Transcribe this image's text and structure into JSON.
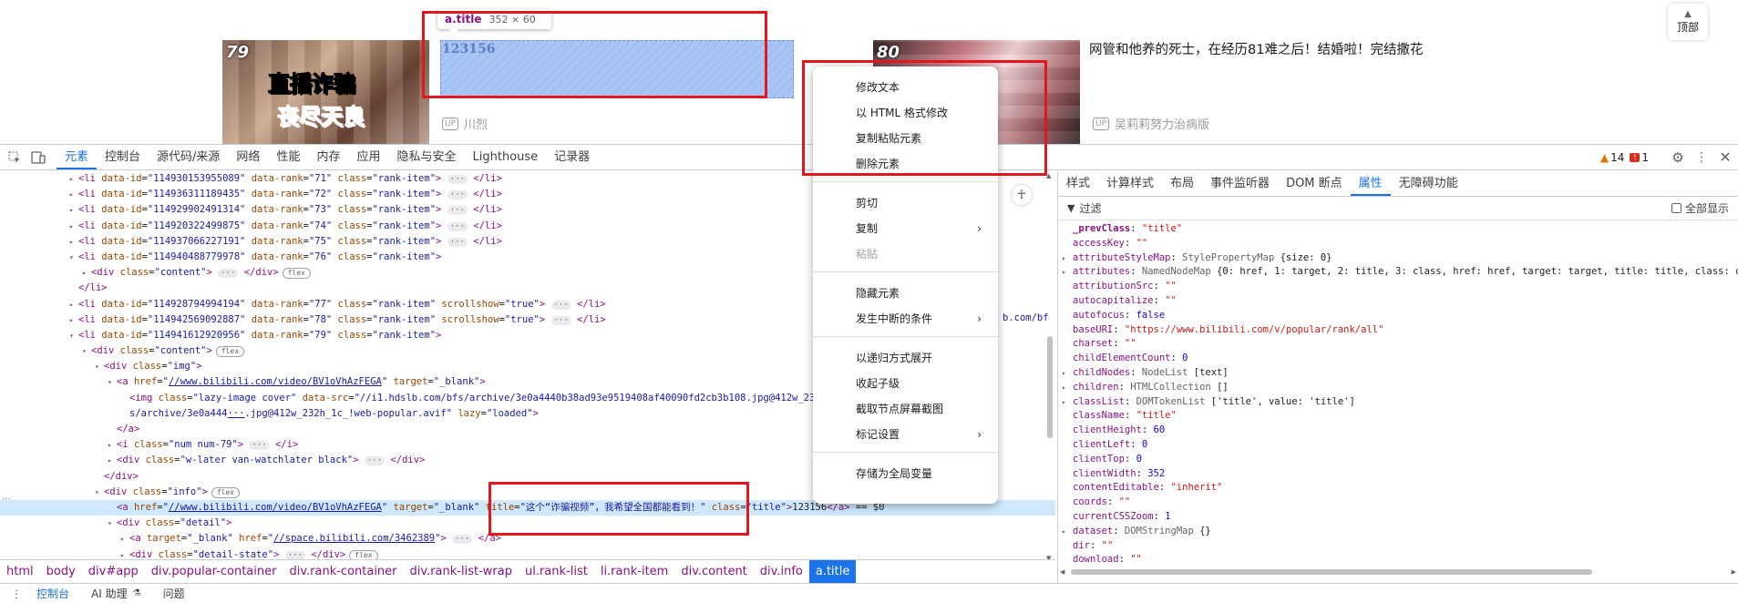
{
  "page_top": {
    "back_to_top": "顶部",
    "card1": {
      "rank": "79",
      "thumb_line1": "直播诈骗",
      "thumb_line2": "丧尽天良",
      "up_badge": "UP",
      "up_name": "川烈"
    },
    "highlight": {
      "tag": "a.title",
      "size": "352 × 60",
      "text": "123156"
    },
    "card2": {
      "rank": "80",
      "title": "网管和他养的死士，在经历81难之后！结婚啦！完结撒花",
      "up_badge": "UP",
      "up_name": "吴莉莉努力治病版"
    }
  },
  "devtools": {
    "tabs": [
      "元素",
      "控制台",
      "源代码/来源",
      "网络",
      "性能",
      "内存",
      "应用",
      "隐私与安全",
      "Lighthouse",
      "记录器"
    ],
    "active_tab": "元素",
    "warnings": "14",
    "errors": "1",
    "side_tabs": [
      "样式",
      "计算样式",
      "布局",
      "事件监听器",
      "DOM 断点",
      "属性",
      "无障碍功能"
    ],
    "active_side_tab": "属性",
    "filter_label": "过滤",
    "show_all": "全部显示",
    "breadcrumbs": [
      "html",
      "body",
      "div#app",
      "div.popular-container",
      "div.rank-container",
      "div.rank-list-wrap",
      "ul.rank-list",
      "li.rank-item",
      "div.content",
      "div.info",
      "a.title"
    ],
    "drawer": [
      "控制台",
      "AI 助理",
      "问题"
    ]
  },
  "dom_lines": [
    {
      "indent": 0,
      "t": "▸",
      "html": "<span class='tg'>&lt;li</span> <span class='an'>data-id</span>=<span class='av'>\"114930153955089\"</span> <span class='an'>data-rank</span>=<span class='av'>\"71\"</span> <span class='an'>class</span>=<span class='av'>\"rank-item\"</span><span class='tg'>&gt;</span> <span class='ell'>···</span> <span class='tg'>&lt;/li&gt;</span>"
    },
    {
      "indent": 0,
      "t": "▸",
      "html": "<span class='tg'>&lt;li</span> <span class='an'>data-id</span>=<span class='av'>\"114936311189435\"</span> <span class='an'>data-rank</span>=<span class='av'>\"72\"</span> <span class='an'>class</span>=<span class='av'>\"rank-item\"</span><span class='tg'>&gt;</span> <span class='ell'>···</span> <span class='tg'>&lt;/li&gt;</span>"
    },
    {
      "indent": 0,
      "t": "▸",
      "html": "<span class='tg'>&lt;li</span> <span class='an'>data-id</span>=<span class='av'>\"114929902491314\"</span> <span class='an'>data-rank</span>=<span class='av'>\"73\"</span> <span class='an'>class</span>=<span class='av'>\"rank-item\"</span><span class='tg'>&gt;</span> <span class='ell'>···</span> <span class='tg'>&lt;/li&gt;</span>"
    },
    {
      "indent": 0,
      "t": "▸",
      "html": "<span class='tg'>&lt;li</span> <span class='an'>data-id</span>=<span class='av'>\"114920322499875\"</span> <span class='an'>data-rank</span>=<span class='av'>\"74\"</span> <span class='an'>class</span>=<span class='av'>\"rank-item\"</span><span class='tg'>&gt;</span> <span class='ell'>···</span> <span class='tg'>&lt;/li&gt;</span>"
    },
    {
      "indent": 0,
      "t": "▸",
      "html": "<span class='tg'>&lt;li</span> <span class='an'>data-id</span>=<span class='av'>\"114937066227191\"</span> <span class='an'>data-rank</span>=<span class='av'>\"75\"</span> <span class='an'>class</span>=<span class='av'>\"rank-item\"</span><span class='tg'>&gt;</span> <span class='ell'>···</span> <span class='tg'>&lt;/li&gt;</span>"
    },
    {
      "indent": 0,
      "t": "▾",
      "html": "<span class='tg'>&lt;li</span> <span class='an'>data-id</span>=<span class='av'>\"114940488779978\"</span> <span class='an'>data-rank</span>=<span class='av'>\"76\"</span> <span class='an'>class</span>=<span class='av'>\"rank-item\"</span><span class='tg'>&gt;</span>"
    },
    {
      "indent": 1,
      "t": "▸",
      "html": "<span class='tg'>&lt;div</span> <span class='an'>class</span>=<span class='av'>\"content\"</span><span class='tg'>&gt;</span> <span class='ell'>···</span> <span class='tg'>&lt;/div&gt;</span><span class='badge'>flex</span>"
    },
    {
      "indent": 0,
      "t": "",
      "html": "<span class='tg'>&lt;/li&gt;</span>"
    },
    {
      "indent": 0,
      "t": "▸",
      "html": "<span class='tg'>&lt;li</span> <span class='an'>data-id</span>=<span class='av'>\"114928794994194\"</span> <span class='an'>data-rank</span>=<span class='av'>\"77\"</span> <span class='an'>class</span>=<span class='av'>\"rank-item\"</span> <span class='an'>scrollshow</span>=<span class='av'>\"true\"</span><span class='tg'>&gt;</span> <span class='ell'>···</span> <span class='tg'>&lt;/li&gt;</span>"
    },
    {
      "indent": 0,
      "t": "▸",
      "html": "<span class='tg'>&lt;li</span> <span class='an'>data-id</span>=<span class='av'>\"114942569092887\"</span> <span class='an'>data-rank</span>=<span class='av'>\"78\"</span> <span class='an'>class</span>=<span class='av'>\"rank-item\"</span> <span class='an'>scrollshow</span>=<span class='av'>\"true\"</span><span class='tg'>&gt;</span> <span class='ell'>···</span> <span class='tg'>&lt;/li&gt;</span>"
    },
    {
      "indent": 0,
      "t": "▾",
      "html": "<span class='tg'>&lt;li</span> <span class='an'>data-id</span>=<span class='av'>\"114941612920956\"</span> <span class='an'>data-rank</span>=<span class='av'>\"79\"</span> <span class='an'>class</span>=<span class='av'>\"rank-item\"</span><span class='tg'>&gt;</span>"
    },
    {
      "indent": 1,
      "t": "▾",
      "html": "<span class='tg'>&lt;div</span> <span class='an'>class</span>=<span class='av'>\"content\"</span><span class='tg'>&gt;</span><span class='badge'>flex</span>"
    },
    {
      "indent": 2,
      "t": "▾",
      "html": "<span class='tg'>&lt;div</span> <span class='an'>class</span>=<span class='av'>\"img\"</span><span class='tg'>&gt;</span>"
    },
    {
      "indent": 3,
      "t": "▾",
      "html": "<span class='tg'>&lt;a</span> <span class='an'>href</span>=<span class='av'>\"<span class='lk'>//www.bilibili.com/video/BV1oVhAzFEGA</span>\"</span> <span class='an'>target</span>=<span class='av'>\"_blank\"</span><span class='tg'>&gt;</span>"
    },
    {
      "indent": 4,
      "t": "",
      "html": "<span class='tg'>&lt;img</span> <span class='an'>class</span>=<span class='av'>\"lazy-image cover\"</span> <span class='an'>data-src</span>=<span class='av'>\"//i1.hdslb.com/bfs/archive/3e0a4440b38ad93e9519408af40090fd2cb3b108.jpg@412w_232h_1c</span>"
    },
    {
      "indent": 4,
      "t": "",
      "html": "<span class='av'>s/archive/3e0a444<span class='lk'>···</span>.jpg@412w_232h_1c_!web-popular.avif\"</span> <span class='an'>lazy</span>=<span class='av'>\"loaded\"</span><span class='tg'>&gt;</span>"
    },
    {
      "indent": 3,
      "t": "",
      "html": "<span class='tg'>&lt;/a&gt;</span>"
    },
    {
      "indent": 3,
      "t": "▸",
      "html": "<span class='tg'>&lt;i</span> <span class='an'>class</span>=<span class='av'>\"num num-79\"</span><span class='tg'>&gt;</span> <span class='ell'>···</span> <span class='tg'>&lt;/i&gt;</span>"
    },
    {
      "indent": 3,
      "t": "▸",
      "html": "<span class='tg'>&lt;div</span> <span class='an'>class</span>=<span class='av'>\"w-later van-watchlater black\"</span><span class='tg'>&gt;</span> <span class='ell'>···</span> <span class='tg'>&lt;/div&gt;</span>"
    },
    {
      "indent": 2,
      "t": "",
      "html": "<span class='tg'>&lt;/div&gt;</span>"
    },
    {
      "indent": 2,
      "t": "▾",
      "html": "<span class='tg'>&lt;div</span> <span class='an'>class</span>=<span class='av'>\"info\"</span><span class='tg'>&gt;</span><span class='badge'>flex</span>"
    },
    {
      "indent": 3,
      "t": "",
      "sel": true,
      "html": "<span class='tg'>&lt;a</span> <span class='an'>href</span>=<span class='av'>\"<span class='lk'>//www.bilibili.com/video/BV1oVhAzFEGA</span>\"</span> <span class='an'>target</span>=<span class='av'>\"_blank\"</span> <span class='an'>title</span>=<span class='av'>\"这个“诈骗视频”，我希望全国都能看到！\"</span> <span class='an'>class</span>=<span class='av'>\"title\"</span><span class='tg'>&gt;</span><span class='tx'>123156</span><span class='tg'>&lt;/a&gt;</span> == $0"
    },
    {
      "indent": 3,
      "t": "▾",
      "html": "<span class='tg'>&lt;div</span> <span class='an'>class</span>=<span class='av'>\"detail\"</span><span class='tg'>&gt;</span>"
    },
    {
      "indent": 4,
      "t": "▸",
      "html": "<span class='tg'>&lt;a</span> <span class='an'>target</span>=<span class='av'>\"_blank\"</span> <span class='an'>href</span>=<span class='av'>\"<span class='lk'>//space.bilibili.com/3462389</span>\"</span><span class='tg'>&gt;</span> <span class='ell'>···</span> <span class='tg'>&lt;/a&gt;</span>"
    },
    {
      "indent": 4,
      "t": "▸",
      "html": "<span class='tg'>&lt;div</span> <span class='an'>class</span>=<span class='av'>\"detail-state\"</span><span class='tg'>&gt;</span> <span class='ell'>···</span> <span class='tg'>&lt;/div&gt;</span><span class='badge'>flex</span>"
    }
  ],
  "dom_right_tail": "b.com/bf",
  "props": [
    {
      "t": "",
      "html": "<span class='pk' style='font-weight:bold'>_prevClass</span>: <span class='ps'>\"title\"</span>"
    },
    {
      "t": "",
      "html": "<span class='pk'>accessKey</span>: <span class='ps'>\"\"</span>"
    },
    {
      "t": "▸",
      "html": "<span class='pk'>attributeStyleMap</span>: <span class='pt'>StylePropertyMap</span>  {size: 0}"
    },
    {
      "t": "▸",
      "html": "<span class='pk'>attributes</span>: <span class='pt'>NamedNodeMap</span>  {0: href, 1: target, 2: title, 3: class, href: href, target: target, title: title, class: class"
    },
    {
      "t": "",
      "html": "<span class='pk'>attributionSrc</span>: <span class='ps'>\"\"</span>"
    },
    {
      "t": "",
      "html": "<span class='pk'>autocapitalize</span>: <span class='ps'>\"\"</span>"
    },
    {
      "t": "",
      "html": "<span class='pk'>autofocus</span>: <span class='pn'>false</span>"
    },
    {
      "t": "",
      "html": "<span class='pk'>baseURI</span>: <span class='ps'>\"https://www.bilibili.com/v/popular/rank/all\"</span>"
    },
    {
      "t": "",
      "html": "<span class='pk'>charset</span>: <span class='ps'>\"\"</span>"
    },
    {
      "t": "",
      "html": "<span class='pk'>childElementCount</span>: <span class='pn'>0</span>"
    },
    {
      "t": "▸",
      "html": "<span class='pk'>childNodes</span>: <span class='pt'>NodeList</span>  [text]"
    },
    {
      "t": "▸",
      "html": "<span class='pk'>children</span>: <span class='pt'>HTMLCollection</span>  []"
    },
    {
      "t": "▸",
      "html": "<span class='pk'>classList</span>: <span class='pt'>DOMTokenList</span>  ['title', value: 'title']"
    },
    {
      "t": "",
      "html": "<span class='pk'>className</span>: <span class='ps'>\"title\"</span>"
    },
    {
      "t": "",
      "html": "<span class='pk'>clientHeight</span>: <span class='pn'>60</span>"
    },
    {
      "t": "",
      "html": "<span class='pk'>clientLeft</span>: <span class='pn'>0</span>"
    },
    {
      "t": "",
      "html": "<span class='pk'>clientTop</span>: <span class='pn'>0</span>"
    },
    {
      "t": "",
      "html": "<span class='pk'>clientWidth</span>: <span class='pn'>352</span>"
    },
    {
      "t": "",
      "html": "<span class='pk'>contentEditable</span>: <span class='ps'>\"inherit\"</span>"
    },
    {
      "t": "",
      "html": "<span class='pk'>coords</span>: <span class='ps'>\"\"</span>"
    },
    {
      "t": "",
      "html": "<span class='pk'>currentCSSZoom</span>: <span class='pn'>1</span>"
    },
    {
      "t": "▸",
      "html": "<span class='pk'>dataset</span>: <span class='pt'>DOMStringMap</span>  {}"
    },
    {
      "t": "",
      "html": "<span class='pk'>dir</span>: <span class='ps'>\"\"</span>"
    },
    {
      "t": "",
      "html": "<span class='pk'>download</span>: <span class='ps'>\"\"</span>"
    }
  ],
  "context_menu": {
    "group1": [
      "修改文本",
      "以 HTML 格式修改",
      "复制粘贴元素",
      "删除元素"
    ],
    "cut": "剪切",
    "copy": "复制",
    "paste": "粘贴",
    "hide": "隐藏元素",
    "break_on": "发生中断的条件",
    "expand": "以递归方式展开",
    "collapse": "收起子级",
    "screenshot": "截取节点屏幕截图",
    "badges": "标记设置",
    "store_global": "存储为全局变量"
  }
}
